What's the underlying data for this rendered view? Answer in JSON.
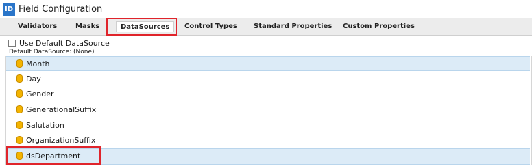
{
  "window": {
    "icon_text": "ID",
    "title": "Field Configuration"
  },
  "tabs": [
    "Validators",
    "Masks",
    "DataSources",
    "Control Types",
    "Standard Properties",
    "Custom Properties"
  ],
  "active_tab": "DataSources",
  "panel": {
    "use_default_label": "Use Default DataSource",
    "use_default_checked": false,
    "default_ds_text": "Default DataSource: (None)"
  },
  "datasources": [
    "Month",
    "Day",
    "Gender",
    "GenerationalSuffix",
    "Salutation",
    "OrganizationSuffix",
    "dsDepartment"
  ],
  "selected_items": [
    "Month",
    "dsDepartment"
  ],
  "colors": {
    "accent_red": "#e0242b",
    "selection_blue": "#dcebf7",
    "db_icon": "#f4b400",
    "app_icon": "#2a75c9"
  }
}
